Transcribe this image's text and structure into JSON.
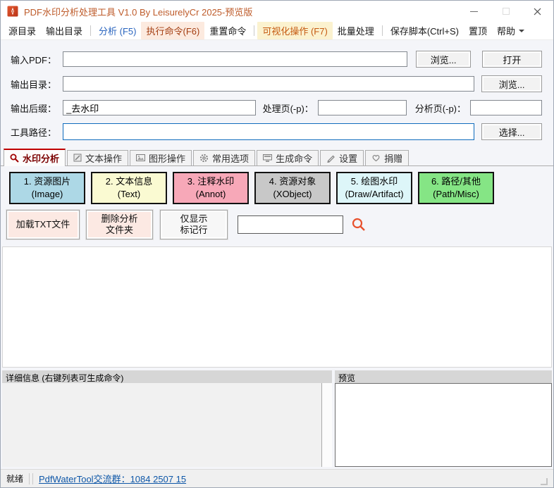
{
  "window": {
    "title": "PDF水印分析处理工具 V1.0 By LeisurelyCr 2025-预览版"
  },
  "menu": {
    "items": [
      {
        "label": "源目录"
      },
      {
        "label": "输出目录"
      },
      {
        "label": "分析 (F5)"
      },
      {
        "label": "执行命令(F6)"
      },
      {
        "label": "重置命令"
      },
      {
        "label": "可视化操作 (F7)"
      },
      {
        "label": "批量处理"
      },
      {
        "label": "保存脚本(Ctrl+S)"
      },
      {
        "label": "置顶"
      },
      {
        "label": "帮助"
      }
    ]
  },
  "form": {
    "input_pdf_label": "输入PDF：",
    "input_pdf_value": "",
    "browse1_label": "浏览...",
    "open_label": "打开",
    "output_dir_label": "输出目录：",
    "output_dir_value": "",
    "browse2_label": "浏览...",
    "suffix_label": "输出后缀：",
    "suffix_value": "_去水印",
    "proc_label": "处理页(-p)：",
    "proc_value": "",
    "ana_label": "分析页(-p)：",
    "ana_value": "",
    "tool_label": "工具路径：",
    "tool_value": "",
    "choose_label": "选择..."
  },
  "tabs": [
    {
      "label": "水印分析"
    },
    {
      "label": "文本操作"
    },
    {
      "label": "图形操作"
    },
    {
      "label": "常用选项"
    },
    {
      "label": "生成命令"
    },
    {
      "label": "设置"
    },
    {
      "label": "捐赠"
    }
  ],
  "categories": [
    {
      "line1": "1. 资源图片",
      "line2": "(Image)",
      "color": "#ADD8E6"
    },
    {
      "line1": "2. 文本信息",
      "line2": "(Text)",
      "color": "#FAFAD2"
    },
    {
      "line1": "3. 注释水印",
      "line2": "(Annot)",
      "color": "#F7A8B8"
    },
    {
      "line1": "4. 资源对象",
      "line2": "(XObject)",
      "color": "#C8C8C8"
    },
    {
      "line1": "5. 绘图水印",
      "line2": "(Draw/Artifact)",
      "color": "#DDF6F9"
    },
    {
      "line1": "6. 路径/其他",
      "line2": "(Path/Misc)",
      "color": "#85E585"
    }
  ],
  "actions": {
    "load_txt": "加载TXT文件",
    "delete_line1": "删除分析",
    "delete_line2": "文件夹",
    "marked_line1": "仅显示",
    "marked_line2": "标记行",
    "search_value": ""
  },
  "panels": {
    "detail_header": "详细信息 (右键列表可生成命令)",
    "preview_header": "预览"
  },
  "status": {
    "ready": "就绪",
    "link": "PdfWaterTool交流群：1084 2507 15"
  },
  "colors": {
    "title_text": "#BE5B2A",
    "active_tab": "#C00000",
    "search_icon": "#E8512D",
    "link": "#0E57A8"
  }
}
